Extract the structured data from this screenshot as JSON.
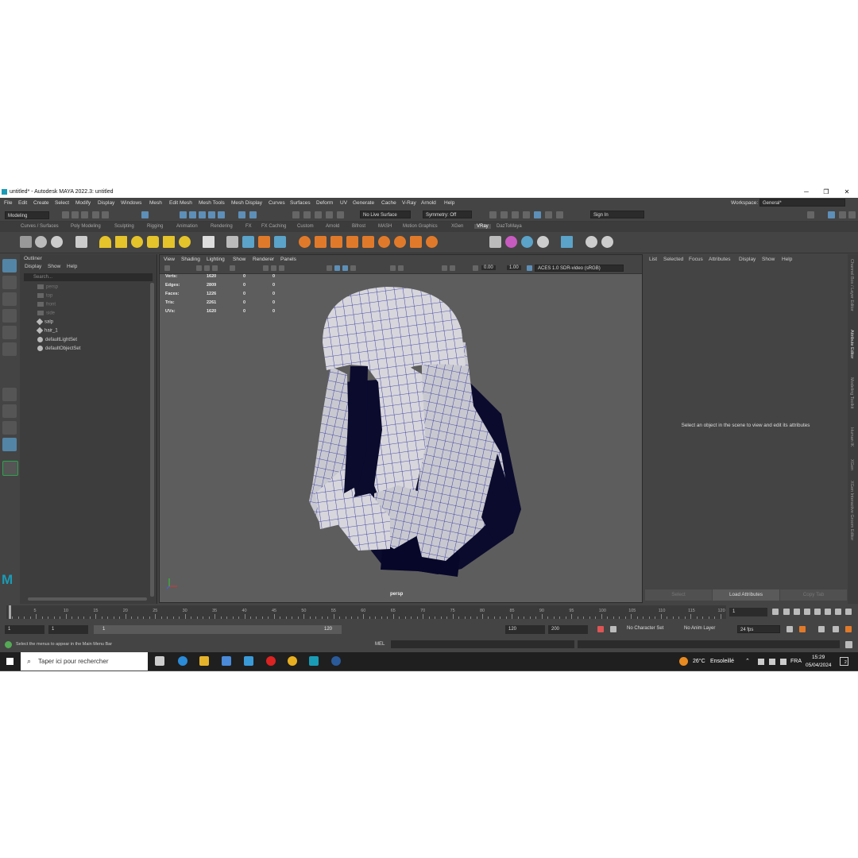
{
  "window": {
    "title": "untitled* - Autodesk MAYA 2022.3: untitled",
    "minimize": "─",
    "maximize": "❐",
    "close": "✕"
  },
  "menubar": {
    "items": [
      "File",
      "Edit",
      "Create",
      "Select",
      "Modify",
      "Display",
      "Windows",
      "Mesh",
      "Edit Mesh",
      "Mesh Tools",
      "Mesh Display",
      "Curves",
      "Surfaces",
      "Deform",
      "UV",
      "Generate",
      "Cache",
      "V-Ray",
      "Arnold",
      "Help"
    ],
    "workspace_label": "Workspace:",
    "workspace_value": "General*"
  },
  "statusline": {
    "mode": "Modeling",
    "live_surface": "No Live Surface",
    "symmetry": "Symmetry: Off",
    "sign_in": "Sign In"
  },
  "shelf": {
    "tabs": [
      "Curves / Surfaces",
      "Poly Modeling",
      "Sculpting",
      "Rigging",
      "Animation",
      "Rendering",
      "FX",
      "FX Caching",
      "Custom",
      "Arnold",
      "Bifrost",
      "MASH",
      "Motion Graphics",
      "XGen",
      "VRay",
      "DazToMaya"
    ],
    "active_tab": "VRay"
  },
  "outliner": {
    "title": "Outliner",
    "menu": [
      "Display",
      "Show",
      "Help"
    ],
    "search_placeholder": "Search...",
    "items": [
      {
        "label": "persp",
        "dim": true
      },
      {
        "label": "top",
        "dim": true
      },
      {
        "label": "front",
        "dim": true
      },
      {
        "label": "side",
        "dim": true
      },
      {
        "label": "salp",
        "dim": false
      },
      {
        "label": "hair_1",
        "dim": false
      },
      {
        "label": "defaultLightSet",
        "dim": false
      },
      {
        "label": "defaultObjectSet",
        "dim": false
      }
    ]
  },
  "viewport": {
    "menu": [
      "View",
      "Shading",
      "Lighting",
      "Show",
      "Renderer",
      "Panels"
    ],
    "exposure": "0.00",
    "gamma": "1.00",
    "color_space": "ACES 1.0 SDR-video (sRGB)",
    "camera": "persp",
    "hud": [
      {
        "label": "Verts:",
        "v1": "1620",
        "v2": "0",
        "v3": "0"
      },
      {
        "label": "Edges:",
        "v1": "2809",
        "v2": "0",
        "v3": "0"
      },
      {
        "label": "Faces:",
        "v1": "1226",
        "v2": "0",
        "v3": "0"
      },
      {
        "label": "Tris:",
        "v1": "2261",
        "v2": "0",
        "v3": "0"
      },
      {
        "label": "UVs:",
        "v1": "1620",
        "v2": "0",
        "v3": "0"
      }
    ]
  },
  "attribute_editor": {
    "menu": [
      "List",
      "Selected",
      "Focus",
      "Attributes",
      "Display",
      "Show",
      "Help"
    ],
    "message": "Select an object in the scene to view and edit its attributes",
    "buttons": [
      "Select",
      "Load Attributes",
      "Copy Tab"
    ]
  },
  "side_tabs": [
    "Channel Box / Layer Editor",
    "Attribute Editor",
    "Modeling Toolkit",
    "Human IK",
    "XGen",
    "XGen Interactive Groom Editor"
  ],
  "timeslider": {
    "ticks": [
      "5",
      "10",
      "15",
      "20",
      "25",
      "30",
      "35",
      "40",
      "45",
      "50",
      "55",
      "60",
      "65",
      "70",
      "75",
      "80",
      "85",
      "90",
      "95",
      "100",
      "105",
      "110",
      "115",
      "120"
    ],
    "current_frame": "1"
  },
  "range": {
    "start": "1",
    "start2": "1",
    "slider_start": "1",
    "slider_end": "120",
    "end": "120",
    "end2": "200",
    "character_set": "No Character Set",
    "anim_layer": "No Anim Layer",
    "fps": "24 fps"
  },
  "cmdline": {
    "help": "Select the menus to appear in the Main Menu Bar",
    "lang": "MEL"
  },
  "taskbar": {
    "search": "Taper ici pour rechercher",
    "weather_temp": "26°C",
    "weather_text": "Ensoleillé",
    "lang": "FRA",
    "time": "15:29",
    "date": "05/04/2024",
    "notifications": "2"
  },
  "colors": {
    "accent": "#5285a6",
    "wire": "#1a1aa0",
    "mesh": "#d8d8de"
  }
}
